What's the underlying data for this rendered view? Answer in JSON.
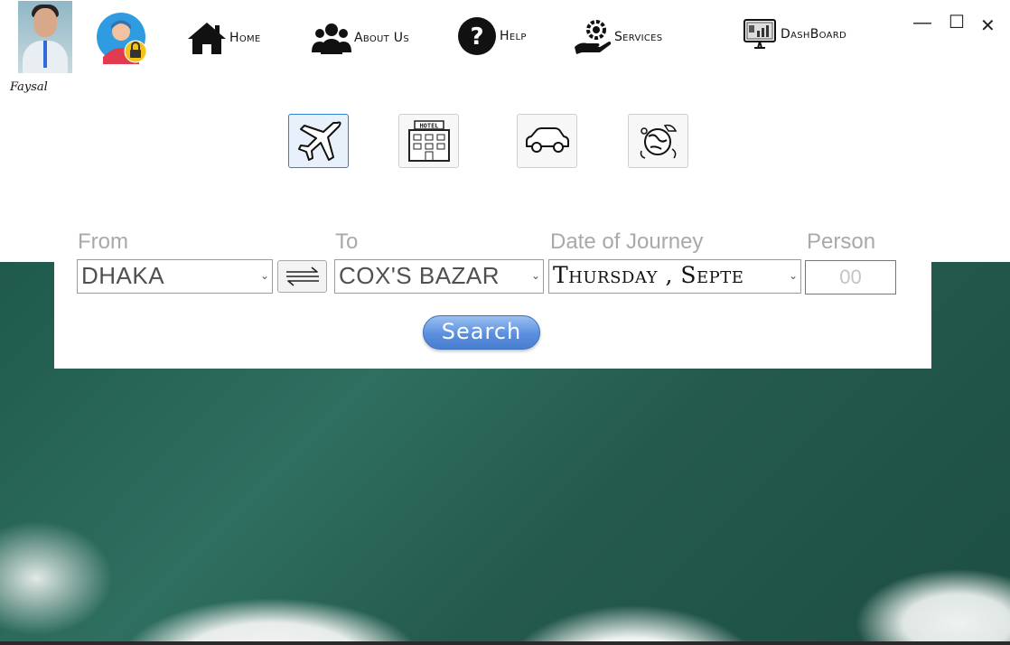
{
  "user": {
    "name": "Faysal"
  },
  "nav": [
    {
      "label": "Home",
      "icon": "home-icon"
    },
    {
      "label": "About Us",
      "icon": "users-icon"
    },
    {
      "label": "Help",
      "icon": "help-icon"
    },
    {
      "label": "Services",
      "icon": "services-icon"
    },
    {
      "label": "DashBoard",
      "icon": "dashboard-icon"
    }
  ],
  "window": {
    "minimize": "—",
    "maximize": "☐",
    "close": "✕"
  },
  "modes": [
    {
      "name": "flight",
      "active": true
    },
    {
      "name": "hotel",
      "text": "HOTEL",
      "active": false
    },
    {
      "name": "car",
      "active": false
    },
    {
      "name": "tour",
      "active": false
    }
  ],
  "form": {
    "from_label": "From",
    "to_label": "To",
    "date_label": "Date of Journey",
    "person_label": "Person",
    "from_value": "DHAKA",
    "to_value": "COX'S BAZAR",
    "date_value": "Thursday , Septe",
    "person_placeholder": "00",
    "search_label": "Search"
  },
  "colors": {
    "accent": "#5a8fe0",
    "label_gray": "#a9a9a9"
  }
}
